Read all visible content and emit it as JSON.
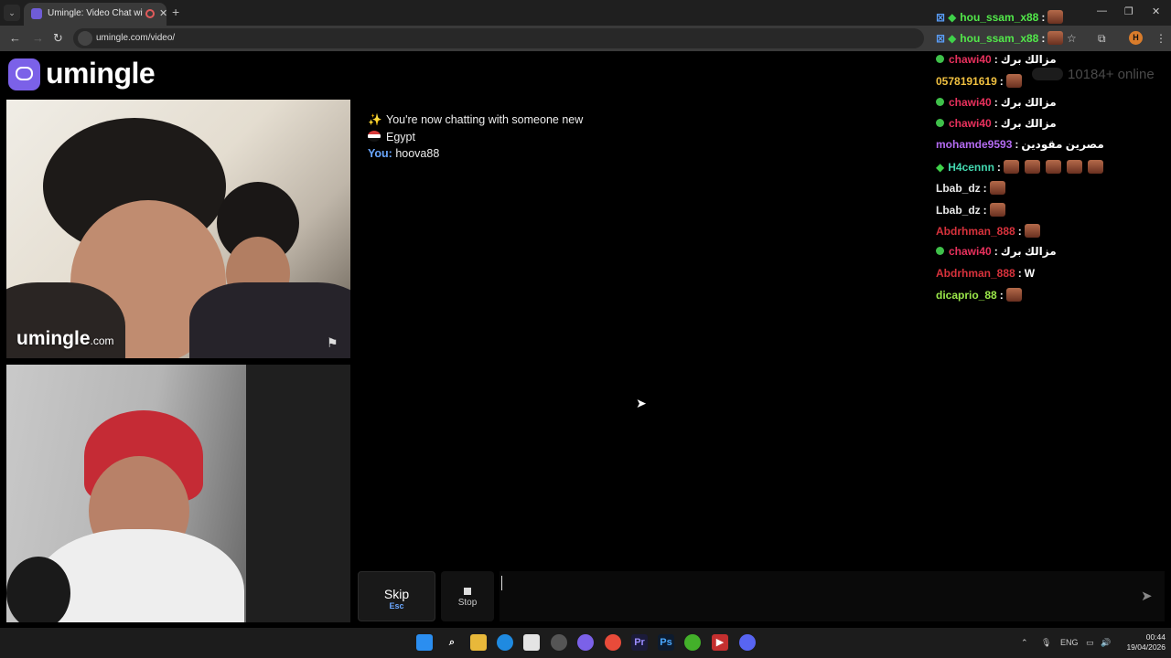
{
  "browser": {
    "tab_title": "Umingle: Video Chat with St",
    "url": "umingle.com/video/",
    "profile_initial": "H"
  },
  "site": {
    "logo_text": "umingle",
    "online_count": "10184+ online",
    "watermark_main": "umingle",
    "watermark_suffix": ".com"
  },
  "chat": {
    "system_message": "You're now chatting with someone new",
    "country": "Egypt",
    "you_label": "You:",
    "you_name": "hoova88",
    "messages": [
      {
        "user": "hou_ssam_x88",
        "color": "#52e84a",
        "text": "",
        "emotes": 1,
        "badge": "tw-diamond"
      },
      {
        "user": "hou_ssam_x88",
        "color": "#52e84a",
        "text": "",
        "emotes": 1,
        "badge": "tw-diamond"
      },
      {
        "user": "chawi40",
        "color": "#e8315d",
        "text": "مزالك برك",
        "emotes": 0,
        "badge": "check"
      },
      {
        "user": "0578191619",
        "color": "#f0c040",
        "text": "",
        "emotes": 1,
        "badge": "none"
      },
      {
        "user": "chawi40",
        "color": "#e8315d",
        "text": "مزالك برك",
        "emotes": 0,
        "badge": "check"
      },
      {
        "user": "chawi40",
        "color": "#e8315d",
        "text": "مزالك برك",
        "emotes": 0,
        "badge": "check"
      },
      {
        "user": "mohamde9593",
        "color": "#b46bf2",
        "text": "مصرين مقودين",
        "emotes": 0,
        "badge": "none"
      },
      {
        "user": "H4cennn",
        "color": "#43d9b0",
        "text": "",
        "emotes": 5,
        "badge": "diamond"
      },
      {
        "user": "Lbab_dz",
        "color": "#e8e8e8",
        "text": "",
        "emotes": 1,
        "badge": "none"
      },
      {
        "user": "Lbab_dz",
        "color": "#e8e8e8",
        "text": "",
        "emotes": 1,
        "badge": "none"
      },
      {
        "user": "Abdrhman_888",
        "color": "#d8323c",
        "text": "",
        "emotes": 1,
        "badge": "none"
      },
      {
        "user": "chawi40",
        "color": "#e8315d",
        "text": "مزالك برك",
        "emotes": 0,
        "badge": "check"
      },
      {
        "user": "Abdrhman_888",
        "color": "#d8323c",
        "text": "W",
        "emotes": 0,
        "badge": "none"
      },
      {
        "user": "dicaprio_88",
        "color": "#9be84a",
        "text": "",
        "emotes": 1,
        "badge": "none"
      }
    ],
    "separator": ":"
  },
  "controls": {
    "skip_label": "Skip",
    "skip_key": "Esc",
    "stop_label": "Stop",
    "input_value": ""
  },
  "taskbar": {
    "lang": "ENG",
    "time": "00:44",
    "date": "19/04/2026"
  },
  "colors": {
    "accent": "#7b61e8",
    "you_label": "#6aa7ff"
  }
}
